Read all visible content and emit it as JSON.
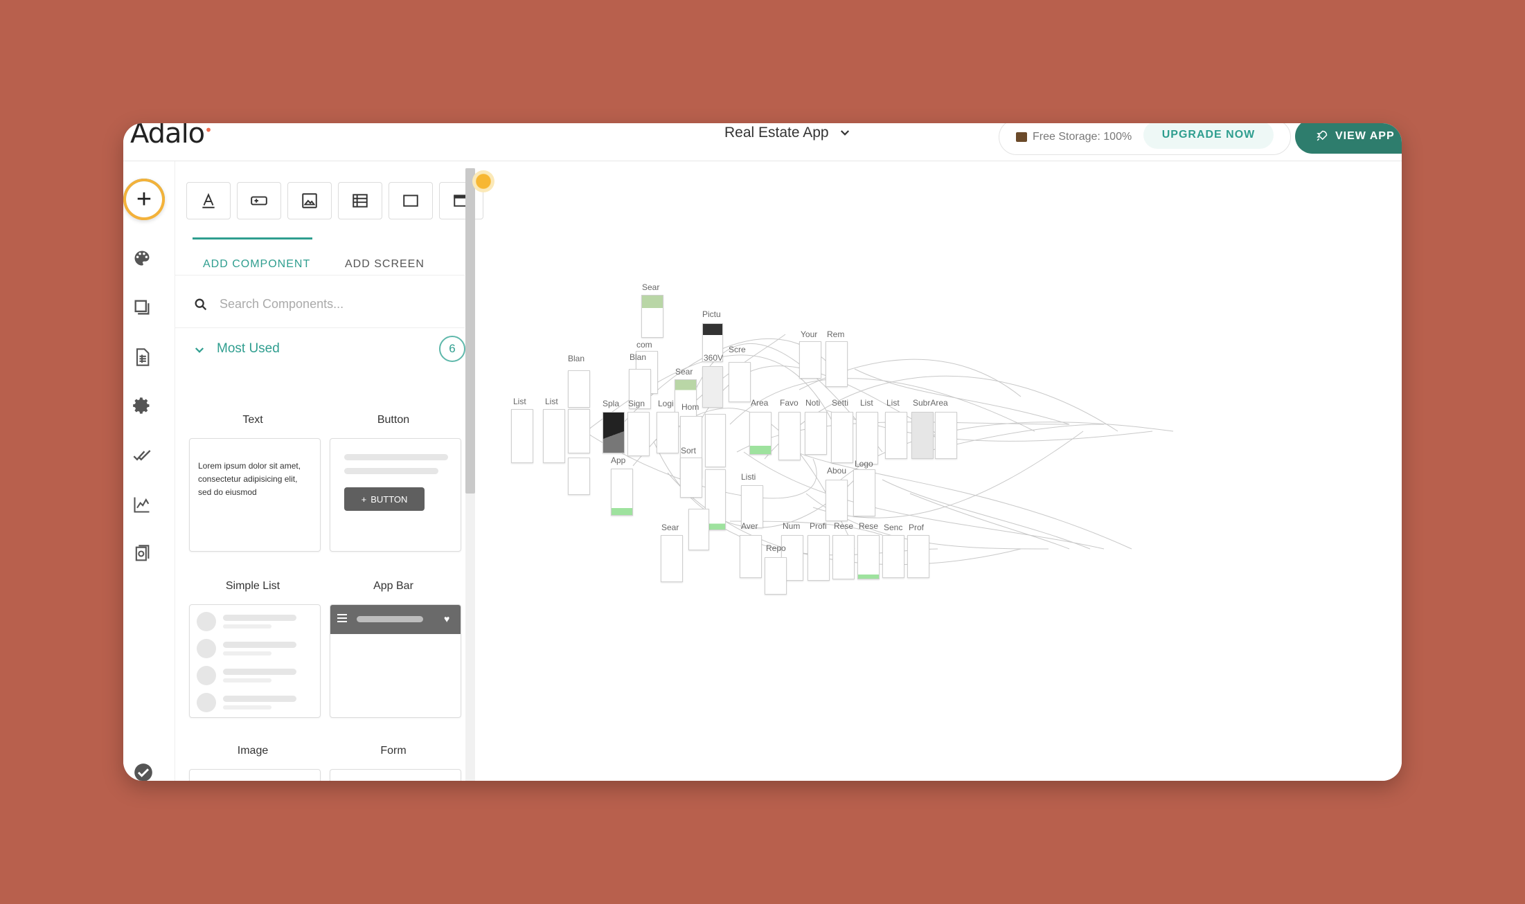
{
  "header": {
    "logo": "Adalo",
    "app_name": "Real Estate App",
    "storage_text": "Free Storage: 100%",
    "upgrade_label": "UPGRADE NOW",
    "view_app_label": "VIEW APP"
  },
  "rail": {
    "add_icon": "plus-icon",
    "items": [
      "palette-icon",
      "screens-icon",
      "database-icon",
      "gear-icon",
      "publish-check-icon",
      "analytics-icon",
      "app-settings-icon"
    ]
  },
  "toolbar": {
    "tools": [
      "text-tool-icon",
      "button-tool-icon",
      "image-tool-icon",
      "list-tool-icon",
      "rectangle-tool-icon",
      "appbar-tool-icon"
    ]
  },
  "tabs": {
    "add_component": "ADD COMPONENT",
    "add_screen": "ADD SCREEN"
  },
  "search": {
    "placeholder": "Search Components..."
  },
  "most_used": {
    "label": "Most Used",
    "count": "6"
  },
  "components": {
    "text": "Text",
    "button": "Button",
    "simple_list": "Simple List",
    "app_bar": "App Bar",
    "image": "Image",
    "form": "Form",
    "lorem": "Lorem ipsum dolor sit amet, consectetur adipisicing elit, sed do eiusmod",
    "button_preview": "BUTTON"
  },
  "canvas": {
    "screen_labels": [
      "Sear",
      "Pictu",
      "com",
      "Blan",
      "Blan",
      "Scre",
      "Your",
      "Rem",
      "360V",
      "Sear",
      "List",
      "List",
      "Spla",
      "Sign",
      "Logi",
      "Hom",
      "Area",
      "Favo",
      "Noti",
      "Setti",
      "List",
      "List",
      "SubrArea",
      "App",
      "Sort",
      "Logo",
      "Abou",
      "Listi",
      "Sear",
      "Aver",
      "Num",
      "Profi",
      "Rese",
      "Rese",
      "Senc",
      "Prof",
      "Repo"
    ]
  },
  "colors": {
    "accent": "#2f9e8f",
    "view_app_bg": "#2e7d6d",
    "background": "#b8604d"
  }
}
